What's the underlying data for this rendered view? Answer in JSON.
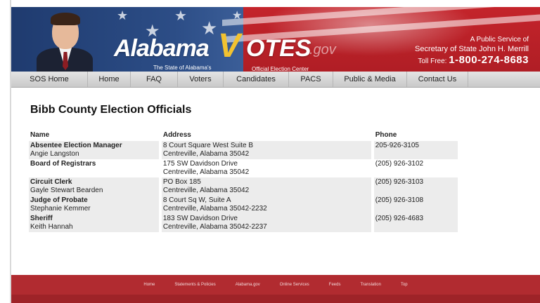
{
  "header": {
    "brand_main": "Alabama",
    "brand_v": "V",
    "brand_votes": "OTES",
    "brand_gov": ".gov",
    "tagline_left": "The State of Alabama's",
    "tagline_right": "Official Election Center",
    "public_service_line1": "A Public Service of",
    "public_service_line2": "Secretary of State John H. Merrill",
    "toll_label": "Toll Free:",
    "toll_number": "1-800-274-8683"
  },
  "nav": {
    "items": [
      {
        "label": "SOS Home"
      },
      {
        "label": "Home"
      },
      {
        "label": "FAQ"
      },
      {
        "label": "Voters"
      },
      {
        "label": "Candidates"
      },
      {
        "label": "PACS"
      },
      {
        "label": "Public & Media"
      },
      {
        "label": "Contact Us"
      }
    ]
  },
  "page": {
    "title": "Bibb County Election Officials"
  },
  "table": {
    "headers": {
      "name": "Name",
      "address": "Address",
      "phone": "Phone"
    },
    "rows": [
      {
        "office": "Absentee Election Manager",
        "person": "Angie Langston",
        "addr1": "8 Court Square West Suite B",
        "addr2": "Centreville, Alabama 35042",
        "phone": "205-926-3105"
      },
      {
        "office": "Board of Registrars",
        "person": "",
        "addr1": "175 SW Davidson Drive",
        "addr2": "Centreville, Alabama 35042",
        "phone": "(205) 926-3102"
      },
      {
        "office": "Circuit Clerk",
        "person": "Gayle Stewart Bearden",
        "addr1": "PO Box 185",
        "addr2": "Centreville, Alabama 35042",
        "phone": "(205) 926-3103"
      },
      {
        "office": "Judge of Probate",
        "person": "Stephanie Kemmer",
        "addr1": "8 Court Sq W, Suite A",
        "addr2": "Centreville, Alabama 35042-2232",
        "phone": "(205) 926-3108"
      },
      {
        "office": "Sheriff",
        "person": "Keith Hannah",
        "addr1": "183 SW Davidson Drive",
        "addr2": "Centreville, Alabama 35042-2237",
        "phone": "(205) 926-4683"
      }
    ]
  },
  "footer": {
    "links": [
      "Home",
      "Statements & Policies",
      "Alabama.gov",
      "Online Services",
      "Feeds",
      "Translation",
      "Top"
    ]
  },
  "colors": {
    "banner_red": "#b01e25",
    "banner_blue": "#1f3b6f",
    "votes_gold": "#f2c230",
    "footer_red": "#b12b30",
    "row_shade": "#ececec"
  }
}
